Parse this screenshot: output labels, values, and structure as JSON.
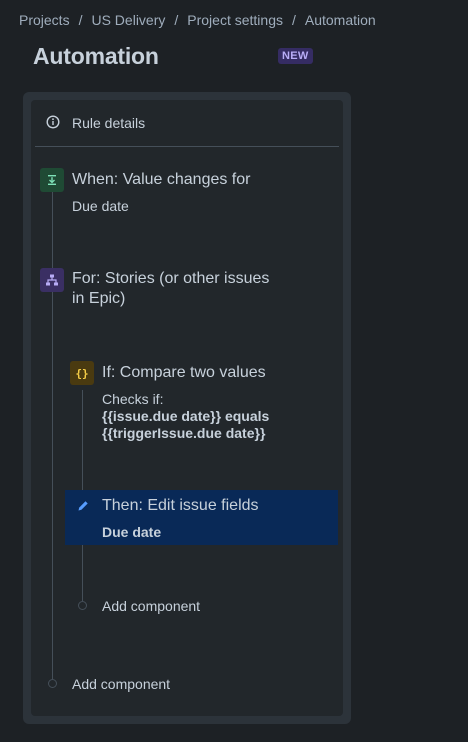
{
  "breadcrumb": {
    "items": [
      "Projects",
      "US Delivery",
      "Project settings",
      "Automation"
    ],
    "separator": "/"
  },
  "page": {
    "title": "Automation",
    "badge": "NEW"
  },
  "rule_details": {
    "label": "Rule details",
    "icon": "info-icon"
  },
  "trigger": {
    "title": "When: Value changes for",
    "subtitle": "Due date",
    "icon": "trigger-icon",
    "color": "#1f4a34"
  },
  "branch": {
    "title_line1": "For: Stories (or other issues",
    "title_line2": "in Epic)",
    "icon": "hierarchy-icon",
    "color": "#3a2f63"
  },
  "condition": {
    "title": "If: Compare two values",
    "line1": "Checks if:",
    "line2": "{{issue.due date}} equals",
    "line3": "{{triggerIssue.due date}}",
    "icon": "braces-icon",
    "color": "#4a3a10"
  },
  "action": {
    "title": "Then: Edit issue fields",
    "subtitle": "Due date",
    "icon": "pencil-icon",
    "highlight_color": "#092957"
  },
  "add_component_inner": "Add component",
  "add_component_outer": "Add component"
}
